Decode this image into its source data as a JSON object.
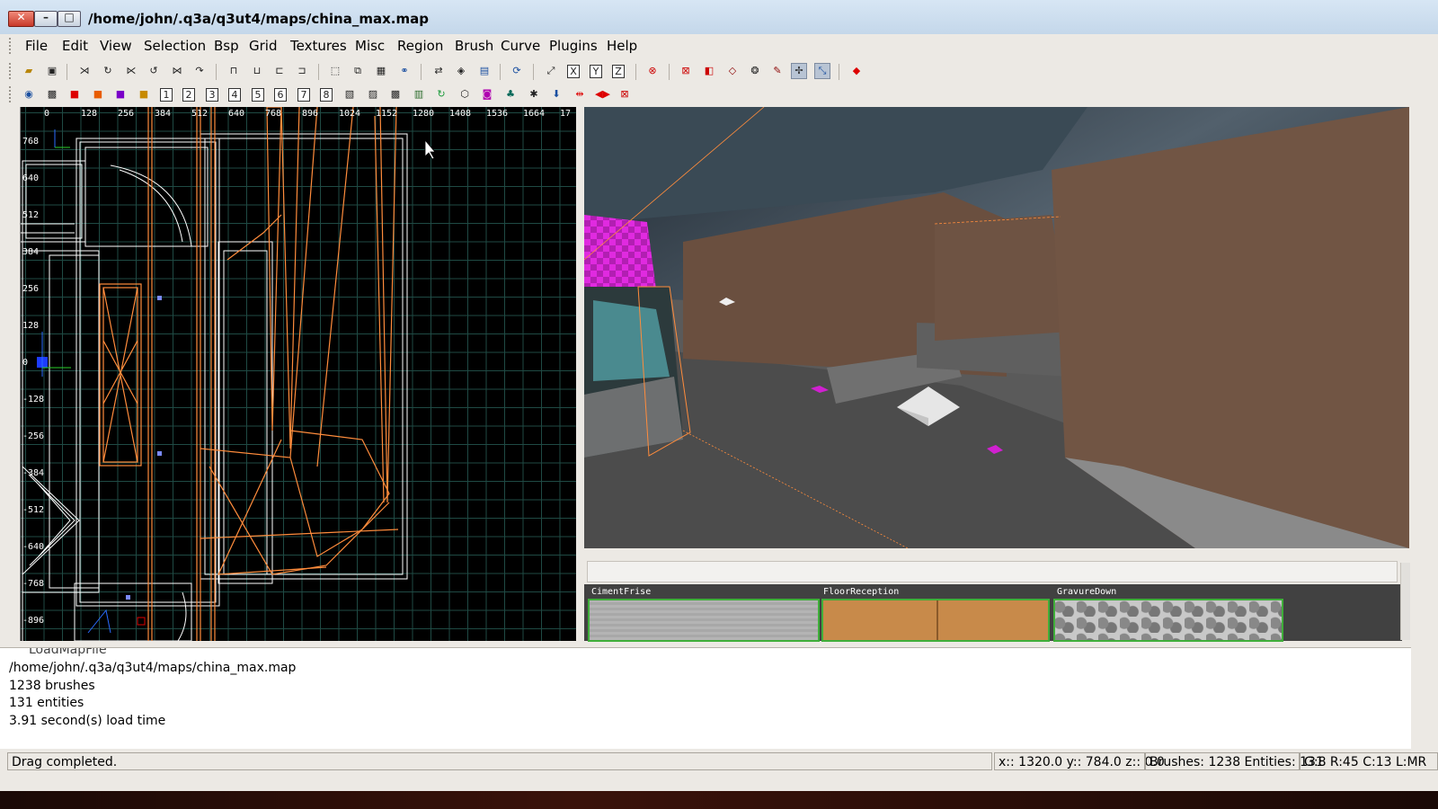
{
  "window": {
    "title": "/home/john/.q3a/q3ut4/maps/china_max.map"
  },
  "menu": [
    "File",
    "Edit",
    "View",
    "Selection",
    "Bsp",
    "Grid",
    "Textures",
    "Misc",
    "Region",
    "Brush",
    "Curve",
    "Plugins",
    "Help"
  ],
  "toolbar2_numbers": [
    "1",
    "2",
    "3",
    "4",
    "5",
    "6",
    "7",
    "8"
  ],
  "ruler": {
    "x_ticks": [
      "0",
      "128",
      "256",
      "384",
      "512",
      "640",
      "768",
      "896",
      "1024",
      "1152",
      "1280",
      "1408",
      "1536",
      "1664",
      "17"
    ],
    "y_ticks": [
      "768",
      "640",
      "512",
      "384",
      "256",
      "128",
      "0",
      "-128",
      "-256",
      "-384",
      "-512",
      "-640",
      "-768",
      "-896"
    ]
  },
  "textures": [
    {
      "name": "CimentFrise"
    },
    {
      "name": "FloorReception"
    },
    {
      "name": "GravureDown"
    }
  ],
  "console": {
    "lines": [
      "LoadMapFile",
      "/home/john/.q3a/q3ut4/maps/china_max.map",
      " 1238 brushes",
      "  131 entities",
      " 3.91 second(s) load time"
    ]
  },
  "status": {
    "message": "Drag completed.",
    "coords": "x:: 1320.0  y:: 784.0  z:: 0.0",
    "counts": "Brushes: 1238 Entities: 131",
    "grid": "G:8 R:45 C:13 L:MR"
  },
  "colors": {
    "brush_selected": "#ff8c3c",
    "grid": "#1f4a44",
    "texture_highlight": "#3fae3a"
  }
}
